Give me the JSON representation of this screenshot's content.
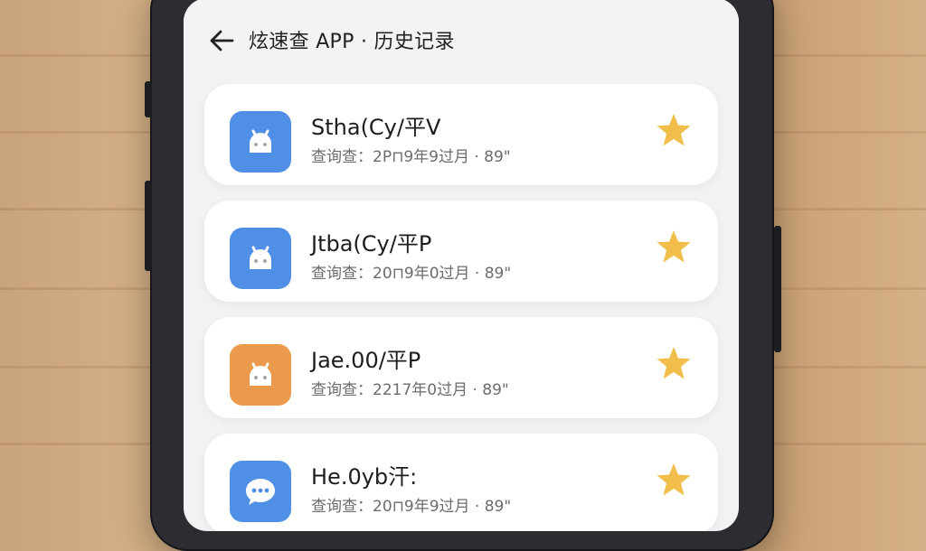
{
  "header": {
    "back_icon": "arrow-left-icon",
    "title": "炫速查 APP · 历史记录"
  },
  "colors": {
    "icon_blue": "#4f8fe6",
    "icon_orange": "#ea9a4a",
    "star_gold": "#f2be4b",
    "card_bg": "#ffffff",
    "screen_bg": "#f2f2f4"
  },
  "history": [
    {
      "name": "Stha(Cy/平V",
      "meta": "查询查：2P⊓9年9过月 · 89\"",
      "icon": "android-icon",
      "icon_color": "#4f8fe6",
      "favorite": true
    },
    {
      "name": "Jtba(Cy/平P",
      "meta": "查询查：20⊓9年0过月 · 89\"",
      "icon": "android-icon",
      "icon_color": "#4f8fe6",
      "favorite": true
    },
    {
      "name": "Jae.00/平P",
      "meta": "查询查：2217年0过月 · 89\"",
      "icon": "android-icon",
      "icon_color": "#ea9a4a",
      "favorite": true
    },
    {
      "name": "He.0yb汗:",
      "meta": "查询查：20⊓9年9过月 · 89\"",
      "icon": "chat-bubble-icon",
      "icon_color": "#4f8fe6",
      "favorite": true
    }
  ]
}
